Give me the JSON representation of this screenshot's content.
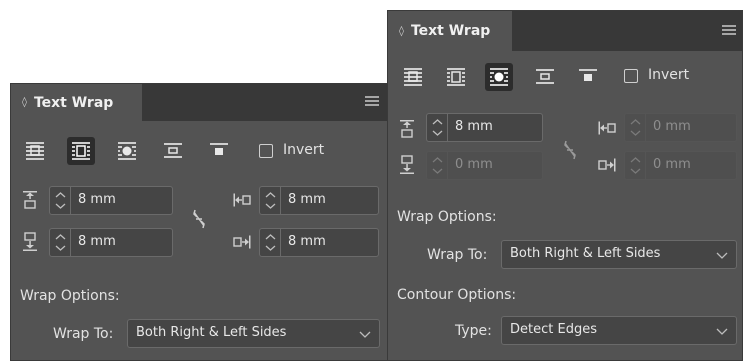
{
  "panel_left": {
    "tab_title": "Text Wrap",
    "invert_label": "Invert",
    "top_offset": "8 mm",
    "bottom_offset": "8 mm",
    "left_offset": "8 mm",
    "right_offset": "8 mm",
    "wrap_options_label": "Wrap Options:",
    "wrap_to_label": "Wrap To:",
    "wrap_to_value": "Both Right & Left Sides",
    "selected_wrap_mode": "wrap-around-bounding-box"
  },
  "panel_right": {
    "tab_title": "Text Wrap",
    "invert_label": "Invert",
    "top_offset": "8 mm",
    "bottom_offset": "0 mm",
    "left_offset": "0 mm",
    "right_offset": "0 mm",
    "wrap_options_label": "Wrap Options:",
    "wrap_to_label": "Wrap To:",
    "wrap_to_value": "Both Right & Left Sides",
    "contour_options_label": "Contour Options:",
    "type_label": "Type:",
    "type_value": "Detect Edges",
    "selected_wrap_mode": "wrap-around-object-shape"
  }
}
